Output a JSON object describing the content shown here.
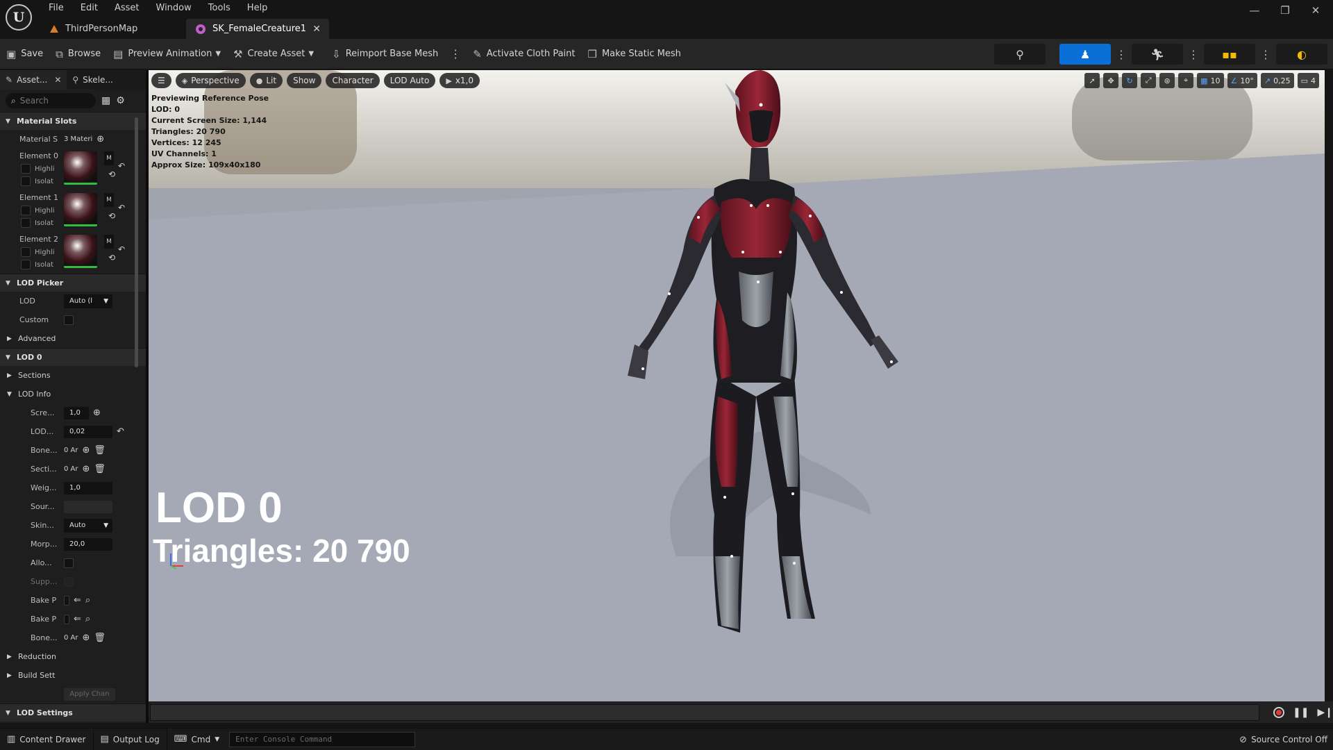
{
  "app": {
    "logo_text": "U",
    "menu": [
      "File",
      "Edit",
      "Asset",
      "Window",
      "Tools",
      "Help"
    ],
    "tabs": [
      {
        "label": "ThirdPersonMap",
        "active": false
      },
      {
        "label": "SK_FemaleCreature1",
        "active": true
      }
    ],
    "window_controls": {
      "minimize": "—",
      "restore": "❐",
      "close": "✕"
    }
  },
  "toolbar": {
    "save": "Save",
    "browse": "Browse",
    "preview_animation": "Preview Animation",
    "create_asset": "Create Asset",
    "reimport_base_mesh": "Reimport Base Mesh",
    "activate_cloth_paint": "Activate Cloth Paint",
    "make_static_mesh": "Make Static Mesh"
  },
  "details": {
    "tabs": {
      "asset_details": "Asset...",
      "skeleton_tree": "Skele..."
    },
    "search_placeholder": "Search",
    "material_slots": {
      "header": "Material Slots",
      "label": "Material S",
      "value": "3 Materi",
      "elements": [
        {
          "label": "Element 0",
          "highlight": "Highli",
          "isolate": "Isolat",
          "side": "M"
        },
        {
          "label": "Element 1",
          "highlight": "Highli",
          "isolate": "Isolat",
          "side": "M"
        },
        {
          "label": "Element 2",
          "highlight": "Highli",
          "isolate": "Isolat",
          "side": "M"
        }
      ]
    },
    "lod_picker": {
      "header": "LOD Picker",
      "lod_label": "LOD",
      "lod_value": "Auto (l",
      "custom_label": "Custom",
      "advanced": "Advanced"
    },
    "lod0": {
      "header": "LOD 0",
      "sections": "Sections",
      "lod_info": "LOD Info",
      "rows": {
        "screen_size": {
          "label": "Scre...",
          "value": "1,0"
        },
        "lod_hysteresis": {
          "label": "LOD...",
          "value": "0,02"
        },
        "bones_to_remove": {
          "label": "Bone...",
          "value": "0 Ar"
        },
        "sections_to_remove": {
          "label": "Secti...",
          "value": "0 Ar"
        },
        "weight": {
          "label": "Weig...",
          "value": "1,0"
        },
        "source": {
          "label": "Sour..."
        },
        "skin_cache": {
          "label": "Skin...",
          "value": "Auto"
        },
        "morph": {
          "label": "Morp...",
          "value": "20,0"
        },
        "allow": {
          "label": "Allo..."
        },
        "support": {
          "label": "Supp..."
        },
        "bake_pose_1": {
          "label": "Bake P"
        },
        "bake_pose_2": {
          "label": "Bake P"
        },
        "bones_to_prioritize": {
          "label": "Bone...",
          "value": "0 Ar"
        }
      },
      "reduction": "Reduction",
      "build_settings": "Build Sett",
      "apply_changes": "Apply Chan"
    },
    "lod_settings": "LOD Settings"
  },
  "viewport": {
    "toolbar": {
      "perspective": "Perspective",
      "lit": "Lit",
      "show": "Show",
      "character": "Character",
      "lod": "LOD Auto",
      "speed": "x1,0"
    },
    "right_controls": {
      "grid_snap": "10",
      "rotation_snap": "10°",
      "scale_snap": "0,25",
      "camera_speed": "4"
    },
    "info_lines": [
      "Previewing Reference Pose",
      "LOD: 0",
      "Current Screen Size: 1,144",
      "Triangles: 20 790",
      "Vertices: 12 245",
      "UV Channels: 1",
      "Approx Size: 109x40x180"
    ],
    "lod_big": "LOD 0",
    "triangles_big": "Triangles: 20 790"
  },
  "statusbar": {
    "content_drawer": "Content Drawer",
    "output_log": "Output Log",
    "cmd": "Cmd",
    "console_placeholder": "Enter Console Command",
    "source_control": "Source Control Off"
  },
  "colors": {
    "accent": "#0a6fd6",
    "character_red": "#8a1f2e",
    "character_grey": "#8c9096",
    "floor": "#a5a9b6"
  }
}
